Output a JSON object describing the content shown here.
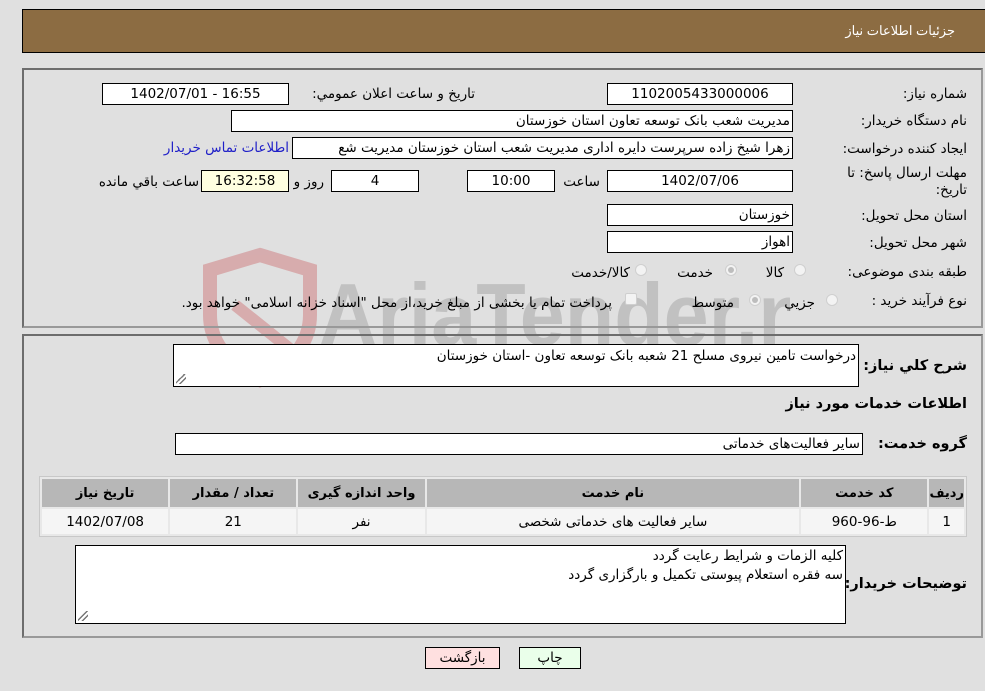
{
  "header": {
    "title": "جزئیات اطلاعات نیاز"
  },
  "form": {
    "need_number": {
      "label": "شماره نیاز:",
      "value": "1102005433000006"
    },
    "announce_datetime": {
      "label": "تاریخ و ساعت اعلان عمومي:",
      "value": "1402/07/01 - 16:55"
    },
    "buyer_org": {
      "label": "نام دستگاه خریدار:",
      "value": "مدیریت شعب بانک توسعه تعاون استان خوزستان"
    },
    "requester": {
      "label": "ایجاد کننده درخواست:",
      "value": "زهرا شیخ زاده سرپرست دایره اداری مدیریت شعب استان خوزستان مدیریت شع"
    },
    "buyer_contact_link": "اطلاعات تماس خریدار",
    "deadline": {
      "label_line1": "مهلت ارسال پاسخ: تا",
      "label_line2": "تاریخ:",
      "date": "1402/07/06",
      "time_label": "ساعت",
      "time": "10:00",
      "days": "4",
      "days_label": "روز و",
      "remaining": "16:32:58",
      "remaining_label": "ساعت باقي مانده"
    },
    "delivery_province": {
      "label": "استان محل تحویل:",
      "value": "خوزستان"
    },
    "delivery_city": {
      "label": "شهر محل تحویل:",
      "value": "اهواز"
    },
    "category": {
      "label": "طبقه بندی موضوعی:",
      "options": [
        "کالا",
        "خدمت",
        "کالا/خدمت"
      ],
      "selected": "خدمت"
    },
    "purchase_type": {
      "label": "نوع فرآیند خرید :",
      "options": [
        "جزيي",
        "متوسط"
      ],
      "selected": "متوسط",
      "treasury_checkbox_label": "پرداخت تمام یا بخشی از مبلغ خرید،از محل \"اسناد خزانه اسلامی\" خواهد بود.",
      "treasury_checked": false
    }
  },
  "details": {
    "description_label": "شرح کلي نیاز:",
    "description": "درخواست تامین نیروی مسلح 21 شعبه بانک توسعه تعاون -استان خوزستان",
    "services_heading": "اطلاعات خدمات مورد نیاز",
    "service_group_label": "گروه خدمت:",
    "service_group": "سایر فعالیت‌های خدماتی",
    "table": {
      "columns": [
        "ردیف",
        "کد خدمت",
        "نام خدمت",
        "واحد اندازه گیری",
        "تعداد / مقدار",
        "تاریخ نیاز"
      ],
      "rows": [
        [
          "1",
          "ط-96-960",
          "سایر فعالیت های خدماتی شخصی",
          "نفر",
          "21",
          "1402/07/08"
        ]
      ]
    },
    "buyer_notes_label": "توضیحات خریدار:",
    "buyer_notes_line1": "کلیه الزمات و شرایط رعایت گردد",
    "buyer_notes_line2": "سه فقره استعلام پیوستی تکمیل و بارگزاری گردد"
  },
  "buttons": {
    "print": "چاپ",
    "back": "بازگشت"
  },
  "watermark": {
    "text": "AriaTender.neT"
  },
  "colors": {
    "header_bg": "#8c6c42",
    "link": "#2020c8",
    "print_bg": "#eaffea",
    "back_bg": "#ffe0e0",
    "remaining_bg": "#ffffe0"
  }
}
